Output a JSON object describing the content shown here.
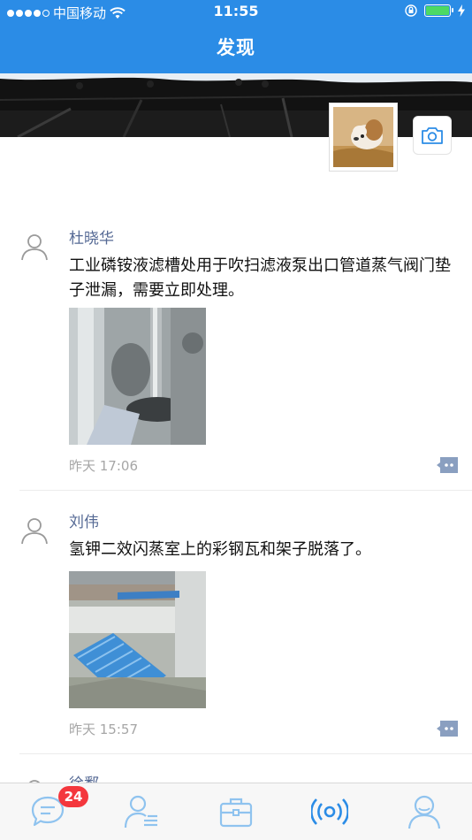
{
  "status_bar": {
    "carrier": "中国移动",
    "time": "11:55"
  },
  "header": {
    "title": "发现"
  },
  "posts": [
    {
      "author": "杜晓华",
      "text": "工业磷铵液滤槽处用于吹扫滤液泵出口管道蒸气阀门垫子泄漏，需要立即处理。",
      "time": "昨天 17:06"
    },
    {
      "author": "刘伟",
      "text": "氢钾二效闪蒸室上的彩钢瓦和架子脱落了。",
      "time": "昨天 15:57"
    },
    {
      "author": "徐鄱"
    }
  ],
  "tabbar": {
    "badge_count": "24",
    "tabs": [
      "messages-icon",
      "contacts-icon",
      "workbench-icon",
      "discover-icon",
      "profile-icon"
    ],
    "active_color": "#2b8ce6",
    "inactive_color": "#8fc3ef"
  }
}
